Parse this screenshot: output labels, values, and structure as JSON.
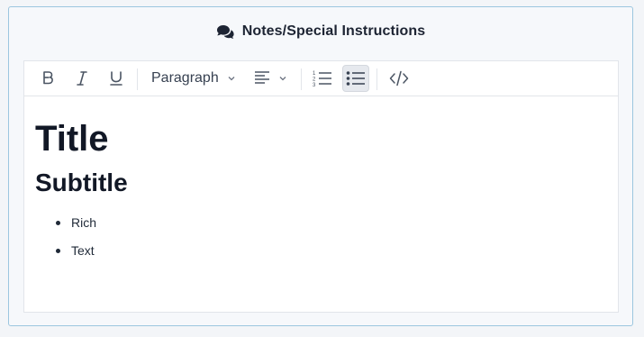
{
  "card": {
    "title": "Notes/Special Instructions",
    "icon": "comments-icon"
  },
  "toolbar": {
    "bold_icon": "bold-icon",
    "italic_icon": "italic-icon",
    "underline_icon": "underline-icon",
    "block_format": "Paragraph",
    "align_icon": "align-left-icon",
    "ordered_list_icon": "ordered-list-icon",
    "bullet_list_icon": "bullet-list-icon",
    "bullet_list_active": true,
    "code_icon": "code-icon"
  },
  "editor": {
    "heading1": "Title",
    "heading2": "Subtitle",
    "bullets": [
      "Rich",
      "Text"
    ]
  },
  "colors": {
    "card_border": "#9cc6df",
    "text_dark": "#121826",
    "active_button_bg": "#e6e9ee"
  }
}
